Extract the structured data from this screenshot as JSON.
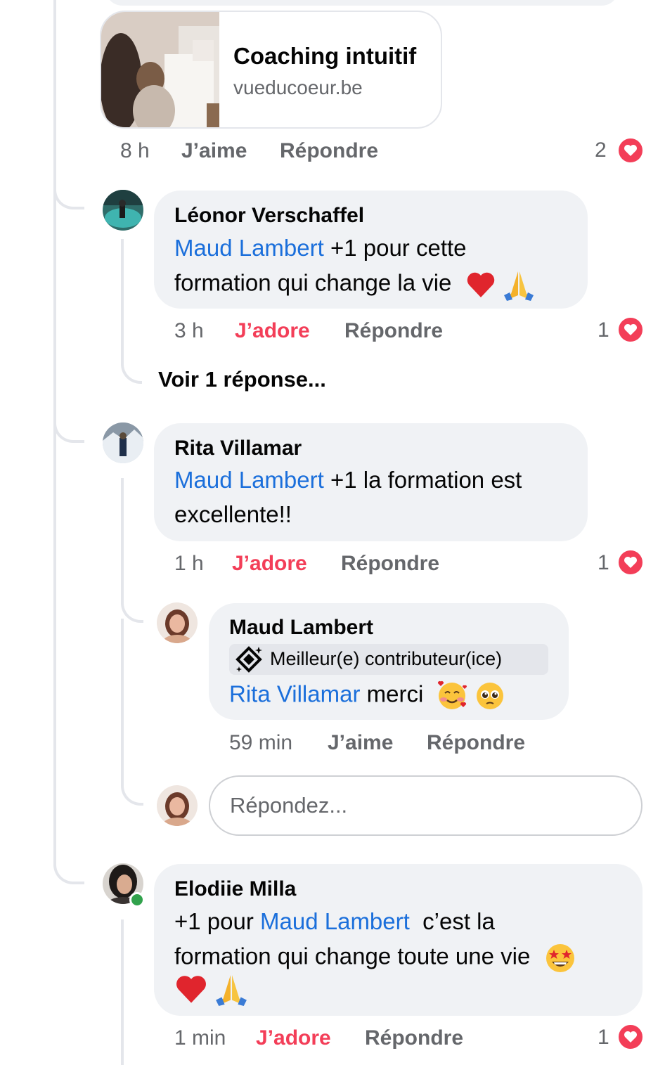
{
  "link_preview": {
    "title": "Coaching intuitif",
    "domain": "vueducoeur.be",
    "time": "8 h",
    "like_label": "J’aime",
    "reply_label": "Répondre",
    "reaction_count": "2"
  },
  "comments": [
    {
      "author": "Léonor Verschaffel",
      "mention": "Maud Lambert",
      "text_line1": " +1 pour cette",
      "text_line2": "formation qui change la vie",
      "emojis": [
        "red-heart",
        "folded-hands"
      ],
      "time": "3 h",
      "reaction_label": "J’adore",
      "reply_label": "Répondre",
      "reaction_count": "1",
      "see_replies": "Voir 1 réponse..."
    },
    {
      "author": "Rita Villamar",
      "mention": "Maud Lambert",
      "text_line1": " +1 la formation est",
      "text_line2": "excellente!!",
      "time": "1 h",
      "reaction_label": "J’adore",
      "reply_label": "Répondre",
      "reaction_count": "1",
      "reply": {
        "author": "Maud Lambert",
        "badge": "Meilleur(e) contributeur(ice)",
        "mention": "Rita Villamar",
        "text": " merci",
        "emojis": [
          "smiling-face-with-hearts",
          "pleading-face"
        ],
        "time": "59 min",
        "like_label": "J’aime",
        "reply_label": "Répondre"
      },
      "reply_input_placeholder": "Répondez..."
    },
    {
      "author": "Elodiie Milla",
      "prefix": "+1 pour ",
      "mention": "Maud Lambert",
      "text_line1": "  c’est la",
      "text_line2": "formation qui change toute une vie",
      "emojis": [
        "star-struck",
        "red-heart",
        "folded-hands"
      ],
      "time": "1 min",
      "reaction_label": "J’adore",
      "reply_label": "Répondre",
      "reaction_count": "1"
    }
  ],
  "colors": {
    "mention_blue": "#1b6fdb",
    "love_red": "#f33e58",
    "bubble_gray": "#f0f2f5",
    "meta_gray": "#65676b"
  }
}
